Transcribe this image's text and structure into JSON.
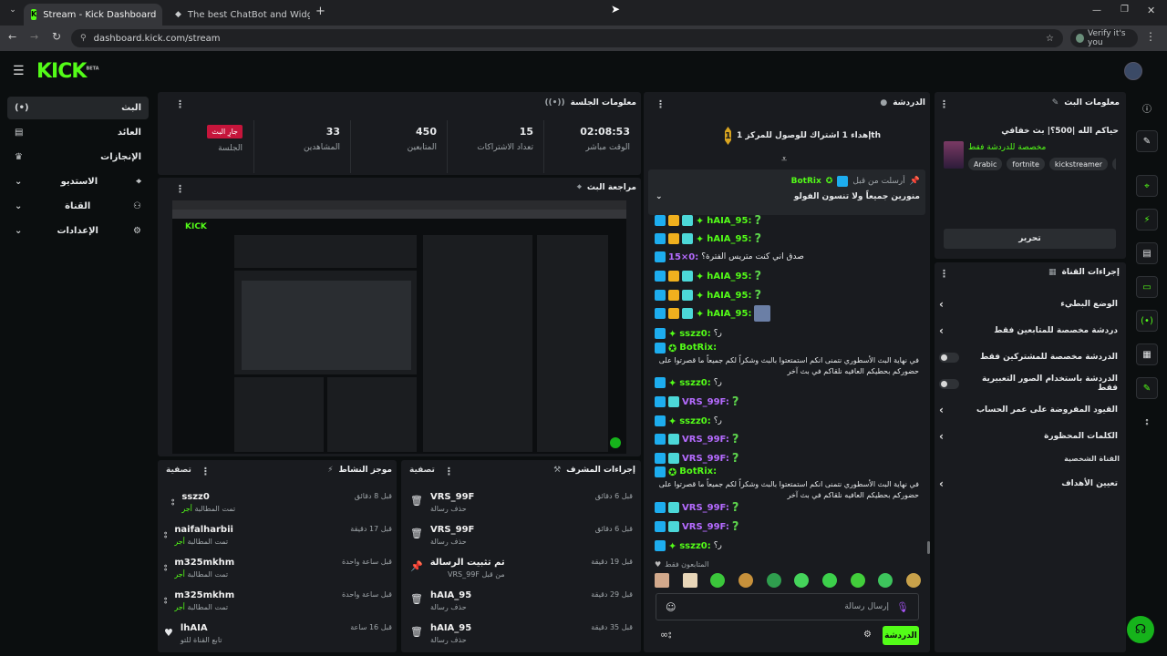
{
  "browser": {
    "tabs": [
      {
        "title": "Stream - Kick Dashboard",
        "active": true
      },
      {
        "title": "The best ChatBot and Widgets",
        "active": false
      }
    ],
    "url": "dashboard.kick.com/stream",
    "verify_label": "Verify it's you"
  },
  "kick": {
    "logo": "KICK",
    "logo_badge": "BETA"
  },
  "sidebar": {
    "items": [
      {
        "label": "البث",
        "icon": "(•)",
        "active": true
      },
      {
        "label": "العائد",
        "icon": "▤"
      },
      {
        "label": "الإنجازات",
        "icon": "♛"
      },
      {
        "label": "الاستديو",
        "icon": "⌖"
      },
      {
        "label": "القناة",
        "icon": "⚇"
      },
      {
        "label": "الإعدادات",
        "icon": "⚙"
      }
    ]
  },
  "session": {
    "title": "معلومات الجلسة",
    "live_badge": "جارِ البث",
    "stats": [
      {
        "value": "",
        "label": "الجلسة"
      },
      {
        "value": "33",
        "label": "المشاهدين"
      },
      {
        "value": "450",
        "label": "المتابعين"
      },
      {
        "value": "15",
        "label": "تعداد الاشتراكات"
      },
      {
        "value": "02:08:53",
        "label": "الوقت مباشر"
      }
    ]
  },
  "preview": {
    "title": "مراجعة البث"
  },
  "activity": {
    "title": "موجز النشاط",
    "filter_label": "تصفية",
    "items": [
      {
        "name": "sszz0",
        "sub": "تمت المطالبة",
        "highlight": "أجر",
        "time": "قبل 8 دقائق",
        "icon": "drops"
      },
      {
        "name": "naifalharbii",
        "sub": "تمت المطالبة",
        "highlight": "أجر",
        "time": "قبل 17 دقيقة",
        "icon": "drops"
      },
      {
        "name": "m325mkhm",
        "sub": "تمت المطالبة",
        "highlight": "أجر",
        "time": "قبل ساعة واحدة",
        "icon": "drops"
      },
      {
        "name": "m325mkhm",
        "sub": "تمت المطالبة",
        "highlight": "أجر",
        "time": "قبل ساعة واحدة",
        "icon": "drops"
      },
      {
        "name": "lhAIA",
        "sub": "تابع القناة للتو",
        "highlight": "",
        "time": "قبل 16 ساعة",
        "icon": "heart"
      }
    ]
  },
  "modactions": {
    "title": "إجراءات المشرف",
    "filter_label": "تصفية",
    "items": [
      {
        "name": "VRS_99F",
        "sub": "حذف رسالة",
        "time": "قبل 6 دقائق",
        "icon": "trash"
      },
      {
        "name": "VRS_99F",
        "sub": "حذف رسالة",
        "time": "قبل 6 دقائق",
        "icon": "trash"
      },
      {
        "name": "تم تثبيت الرسالة",
        "sub": "من قبل VRS_99F",
        "time": "قبل 19 دقيقة",
        "icon": "pin"
      },
      {
        "name": "hAIA_95",
        "sub": "حذف رسالة",
        "time": "قبل 29 دقيقة",
        "icon": "trash"
      },
      {
        "name": "hAIA_95",
        "sub": "حذف رسالة",
        "time": "قبل 35 دقيقة",
        "icon": "trash"
      }
    ]
  },
  "chat": {
    "title": "الدردشة",
    "goal_text": "إهداء 1 اشتراك للوصول للمركز 1th",
    "goal_rank": "1",
    "pinned": {
      "by_label": "أرسلت من قبل",
      "user": "BotRix",
      "message": "منورين جميعاً ولا تنسون الفولو"
    },
    "messages": [
      {
        "user": "hAIA_95:",
        "badges": [
          "blue",
          "gold",
          "teal",
          "lime"
        ],
        "text": "?",
        "kind": "q"
      },
      {
        "user": "hAIA_95:",
        "badges": [
          "blue",
          "gold",
          "teal",
          "lime"
        ],
        "text": "?",
        "kind": "q"
      },
      {
        "user": "15×0:",
        "badges": [
          "blue"
        ],
        "text": "صدق اني كنت متريس الفترة؟",
        "kind": "text",
        "purple": true
      },
      {
        "user": "hAIA_95:",
        "badges": [
          "blue",
          "gold",
          "teal",
          "lime"
        ],
        "text": "?",
        "kind": "q"
      },
      {
        "user": "hAIA_95:",
        "badges": [
          "blue",
          "gold",
          "teal",
          "lime"
        ],
        "text": "?",
        "kind": "q"
      },
      {
        "user": "hAIA_95:",
        "badges": [
          "blue",
          "gold",
          "teal",
          "lime"
        ],
        "text": "",
        "kind": "emote"
      },
      {
        "user": "sszz0:",
        "badges": [
          "blue",
          "lime"
        ],
        "text": "ر؟",
        "kind": "text"
      },
      {
        "user": "BotRix:",
        "badges": [
          "blue",
          "verified"
        ],
        "text": "في نهاية البث الأسطوري نتمنى انكم استمتعتوا بالبث وشكراً لكم جميعاً ما قصرتوا على حضوركم بحطيكم العافيه نلقاكم في بث آخر",
        "kind": "bot"
      },
      {
        "user": "sszz0:",
        "badges": [
          "blue",
          "lime"
        ],
        "text": "ر؟",
        "kind": "text"
      },
      {
        "user": "VRS_99F:",
        "badges": [
          "blue",
          "teal"
        ],
        "text": "?",
        "kind": "q",
        "purple": true
      },
      {
        "user": "sszz0:",
        "badges": [
          "blue",
          "lime"
        ],
        "text": "ر؟",
        "kind": "text"
      },
      {
        "user": "VRS_99F:",
        "badges": [
          "blue",
          "teal"
        ],
        "text": "?",
        "kind": "q",
        "purple": true
      },
      {
        "user": "VRS_99F:",
        "badges": [
          "blue",
          "teal"
        ],
        "text": "?",
        "kind": "q",
        "purple": true
      },
      {
        "user": "BotRix:",
        "badges": [
          "blue",
          "verified"
        ],
        "text": "في نهاية البث الأسطوري نتمنى انكم استمتعتوا بالبث وشكراً لكم جميعاً ما قصرتوا على حضوركم بحطيكم العافيه نلقاكم في بث آخر",
        "kind": "bot"
      },
      {
        "user": "VRS_99F:",
        "badges": [
          "blue",
          "teal"
        ],
        "text": "?",
        "kind": "q",
        "purple": true
      },
      {
        "user": "VRS_99F:",
        "badges": [
          "blue",
          "teal"
        ],
        "text": "?",
        "kind": "q",
        "purple": true
      },
      {
        "user": "sszz0:",
        "badges": [
          "blue",
          "lime"
        ],
        "text": "ر؟",
        "kind": "text"
      }
    ],
    "followers_only": "المتابعون فقط",
    "input_placeholder": "إرسال رسالة",
    "send_label": "الدردشة"
  },
  "streaminfo": {
    "title": "معلومات البث",
    "stream_title": "حياكم الله |500؟| بث خفافي",
    "category": "مخصصة للدردشة فقط",
    "tags": [
      "Arabic",
      "fortnite",
      "kickstreamer",
      "a"
    ],
    "edit_label": "تحرير"
  },
  "channel_actions": {
    "title": "إجراءات القناة",
    "options": [
      {
        "label": "الوضع البطيء",
        "control": "chevron"
      },
      {
        "label": "دردشة مخصصة للمتابعين فقط",
        "control": "chevron"
      },
      {
        "label": "الدردشة مخصصة للمشتركين فقط",
        "control": "toggle"
      },
      {
        "label": "الدردشة باستخدام الصور التعبيرية فقط",
        "control": "toggle"
      },
      {
        "label": "القيود المفروضة على عمر الحساب",
        "control": "chevron"
      },
      {
        "label": "الكلمات المحظورة",
        "control": "chevron"
      }
    ],
    "section_label": "القناة الشخصية",
    "goals_label": "تعيين الأهداف"
  },
  "colors": {
    "accent": "#53fc18",
    "live": "#c6153b",
    "panel": "#191b1f"
  }
}
